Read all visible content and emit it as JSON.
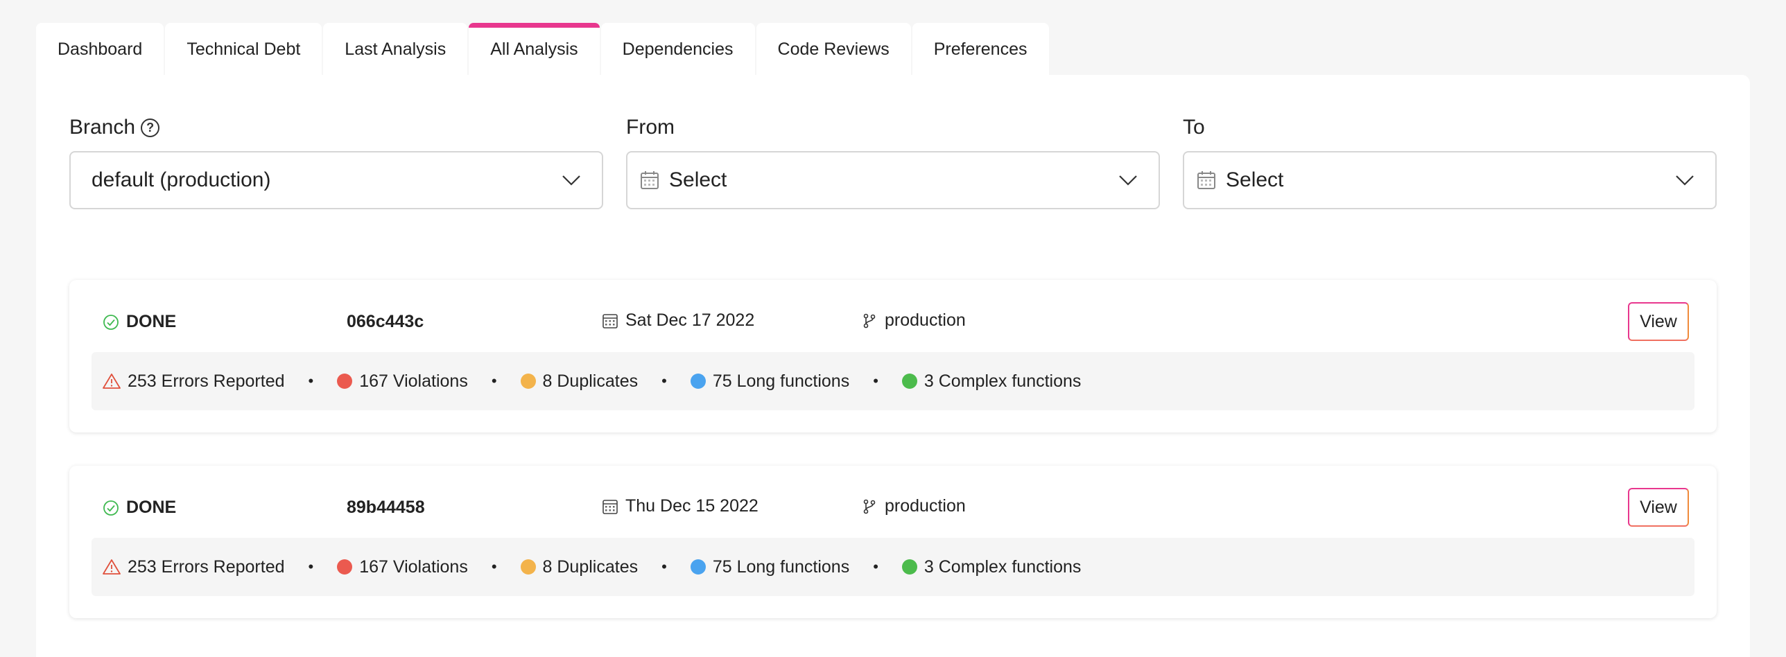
{
  "tabs": [
    {
      "label": "Dashboard"
    },
    {
      "label": "Technical Debt"
    },
    {
      "label": "Last Analysis"
    },
    {
      "label": "All Analysis",
      "active": true
    },
    {
      "label": "Dependencies"
    },
    {
      "label": "Code Reviews"
    },
    {
      "label": "Preferences"
    }
  ],
  "filters": {
    "branch": {
      "label": "Branch",
      "value": "default (production)",
      "icon": "help-icon"
    },
    "from": {
      "label": "From",
      "value": "Select",
      "icon": "calendar-icon"
    },
    "to": {
      "label": "To",
      "value": "Select",
      "icon": "calendar-icon"
    }
  },
  "colors": {
    "accent": "#e8378e",
    "done": "#3fb950",
    "warning": "#e0503c",
    "violations": "#eb5a4f",
    "duplicates": "#f3b34b",
    "long_functions": "#4aa3ef",
    "complex_functions": "#4cbb4c"
  },
  "analyses": [
    {
      "status": "DONE",
      "hash": "066c443c",
      "date": "Sat Dec 17 2022",
      "branch": "production",
      "view_label": "View",
      "errors": "253 Errors Reported",
      "violations": "167 Violations",
      "duplicates": "8 Duplicates",
      "long_functions": "75 Long functions",
      "complex_functions": "3 Complex functions"
    },
    {
      "status": "DONE",
      "hash": "89b44458",
      "date": "Thu Dec 15 2022",
      "branch": "production",
      "view_label": "View",
      "errors": "253 Errors Reported",
      "violations": "167 Violations",
      "duplicates": "8 Duplicates",
      "long_functions": "75 Long functions",
      "complex_functions": "3 Complex functions"
    }
  ],
  "separator": "•"
}
